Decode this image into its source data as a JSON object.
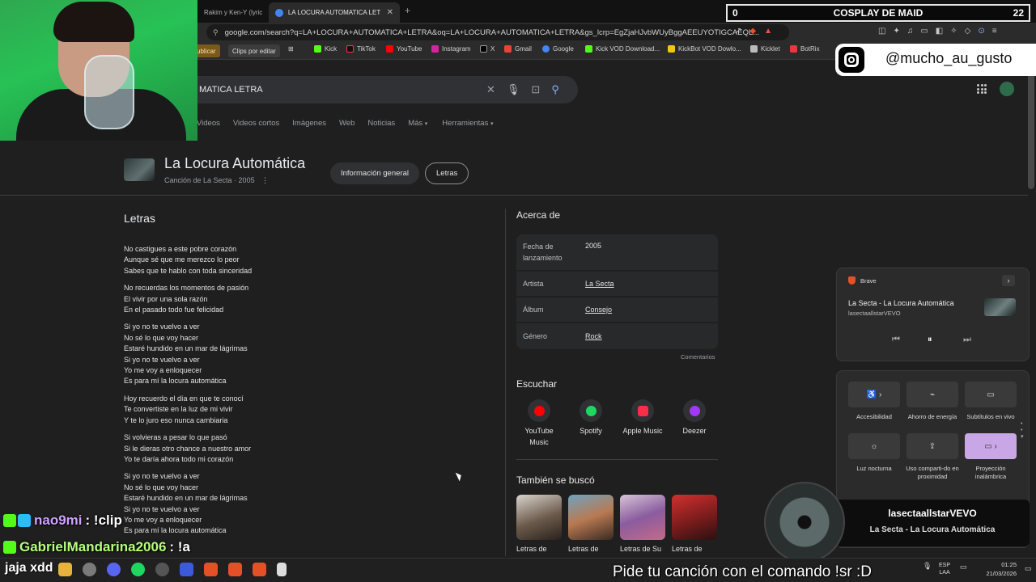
{
  "browser": {
    "tabs": [
      {
        "title": "Rakim y Ken-Y (lyric"
      },
      {
        "title": "LA LOCURA AUTOMATICA LETRA"
      }
    ],
    "new_tab": "+",
    "url": "google.com/search?q=LA+LOCURA+AUTOMATICA+LETRA&oq=LA+LOCURA+AUTOMATICA+LETRA&gs_lcrp=EgZjaHJvbWUyBggAEEUYOTIGCAEQL...",
    "bookmarks": [
      "ublicar",
      "Clips por editar",
      "Kick",
      "TikTok",
      "YouTube",
      "Instagram",
      "X",
      "Gmail",
      "Google",
      "Kick VOD Download...",
      "KickBot VOD Dowlo...",
      "Kicklet",
      "BotRix"
    ]
  },
  "search": {
    "query": "MATICA LETRA",
    "tabs": [
      "Videos",
      "Videos cortos",
      "Imágenes",
      "Web",
      "Noticias",
      "Más",
      "Herramientas"
    ]
  },
  "knowledge_panel": {
    "title": "La Locura Automática",
    "subtitle": "Canción de La Secta · 2005",
    "chips": [
      "Información general",
      "Letras"
    ]
  },
  "lyrics": {
    "heading": "Letras",
    "stanzas": [
      "No castigues a este pobre corazón\nAunque sé que me merezco lo peor\nSabes que te hablo con toda sinceridad",
      "No recuerdas los momentos de pasión\nEl vivir por una sola razón\nEn el pasado todo fue felicidad",
      "Si yo no te vuelvo a ver\nNo sé lo que voy hacer\nEstaré hundido en un mar de lágrimas\nSi yo no te vuelvo a ver\nYo me voy a enloquecer\nEs para mí la locura automática",
      "Hoy recuerdo el día en que te conocí\nTe convertiste en la luz de mi vivir\nY te lo juro eso nunca cambiaria",
      "Si volvieras a pesar lo que pasó\nSi le dieras otro chance a nuestro amor\nYo te daría ahora todo mi corazón",
      "Si yo no te vuelvo a ver\nNo sé lo que voy hacer\nEstaré hundido en un mar de lágrimas\nSi yo no te vuelvo a ver\nYo me voy a enloquecer\nEs para mí la locura automática"
    ]
  },
  "about": {
    "heading": "Acerca de",
    "rows": [
      {
        "key": "Fecha de lanzamiento",
        "value": "2005"
      },
      {
        "key": "Artista",
        "value": "La Secta"
      },
      {
        "key": "Álbum",
        "value": "Consejo"
      },
      {
        "key": "Género",
        "value": "Rock"
      }
    ],
    "comments": "Comentarios"
  },
  "listen": {
    "heading": "Escuchar",
    "services": [
      {
        "name": "YouTube Music",
        "color": "#ff0000"
      },
      {
        "name": "Spotify",
        "color": "#1ed760"
      },
      {
        "name": "Apple Music",
        "color": "#fa2d48"
      },
      {
        "name": "Deezer",
        "color": "#a238ff"
      }
    ]
  },
  "also_searched": {
    "heading": "También se buscó",
    "items": [
      "Letras de",
      "Letras de",
      "Letras de Su",
      "Letras de"
    ]
  },
  "media_flyout": {
    "app": "Brave",
    "title": "La Secta - La Locura Automática",
    "artist": "lasectaallstarVEVO"
  },
  "quick_settings": [
    {
      "label": "Accesibilidad",
      "icon": "accessibility-icon",
      "on": false
    },
    {
      "label": "Ahorro de energía",
      "icon": "energy-saver-icon",
      "on": false
    },
    {
      "label": "Subtítulos en vivo",
      "icon": "live-captions-icon",
      "on": false
    },
    {
      "label": "Luz nocturna",
      "icon": "night-light-icon",
      "on": false
    },
    {
      "label": "Uso comparti-do en proximidad",
      "icon": "nearby-share-icon",
      "on": false
    },
    {
      "label": "Proyección inalámbrica",
      "icon": "cast-icon",
      "on": true
    }
  ],
  "overlay": {
    "goal": {
      "left": "0",
      "title": "COSPLAY DE MAID",
      "right": "22"
    },
    "instagram": "@mucho_au_gusto",
    "chat": [
      {
        "user": "nao9mi",
        "message": ": !clip"
      },
      {
        "user": "GabrielMandarina2006",
        "message": ": !a"
      }
    ],
    "chat_extra": "jaja xdd",
    "now_playing": {
      "user": "lasectaallstarVEVO",
      "song": "La Secta - La Locura Automática"
    },
    "song_prompt": "Pide tu canción con el comando !sr :D"
  },
  "taskbar": {
    "lang": "ESP\nLAA",
    "time": "01:25",
    "date": "21/03/2026"
  }
}
